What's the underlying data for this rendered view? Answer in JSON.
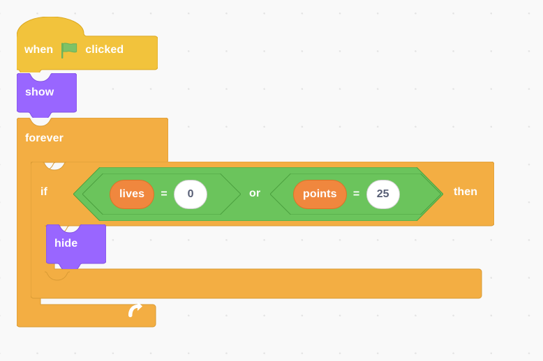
{
  "workspace": {
    "name": "scratch-block-workspace",
    "background_color": "#f9f9f9",
    "grid_dot_color": "#e4e4e4"
  },
  "palette": {
    "events_hat": "#f2c33c",
    "events_hat_border": "#dba820",
    "control_orange": "#f3ae43",
    "control_orange_border": "#d89a34",
    "looks_purple": "#9966ff",
    "looks_purple_border": "#8151e0",
    "operators_green": "#6bc45c",
    "operators_green_border": "#4ca03f",
    "variables_orange": "#f0873e",
    "variables_orange_border": "#da7326",
    "input_white": "#ffffff",
    "input_text": "#575e75",
    "block_text": "#ffffff",
    "flag_green": "#6eb35b"
  },
  "script": {
    "hat": {
      "type": "event_whenflagclicked",
      "word_before": "when",
      "icon": "green-flag-icon",
      "word_after": "clicked"
    },
    "show_block": {
      "type": "looks_show",
      "label": "show"
    },
    "forever_block": {
      "type": "control_forever",
      "label": "forever",
      "loop_icon": "loop-arrow-icon"
    },
    "if_block": {
      "type": "control_if",
      "label": "if",
      "label_end": "then"
    },
    "condition": {
      "type": "operator_or",
      "label": "or",
      "operand_left": {
        "type": "operator_equals",
        "operator": "=",
        "left_variable": "lives",
        "right_value": "0"
      },
      "operand_right": {
        "type": "operator_equals",
        "operator": "=",
        "left_variable": "points",
        "right_value": "25"
      }
    },
    "hide_block": {
      "type": "looks_hide",
      "label": "hide"
    }
  }
}
